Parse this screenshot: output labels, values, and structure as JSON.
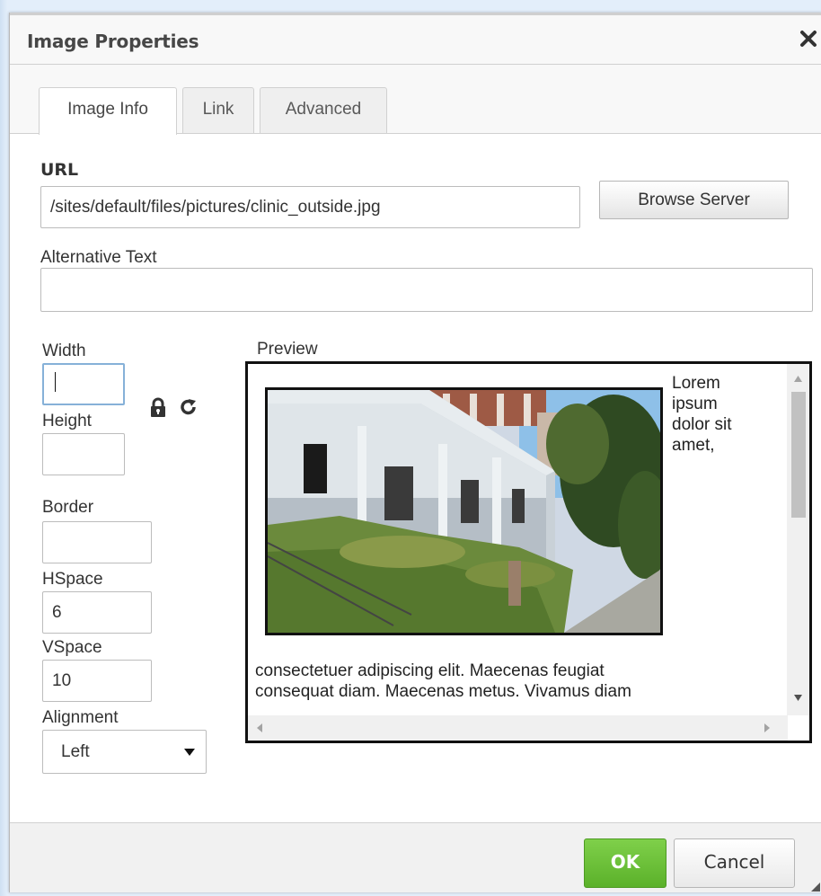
{
  "dialog": {
    "title": "Image Properties",
    "close_glyph": "✕"
  },
  "tabs": [
    {
      "label": "Image Info",
      "active": true
    },
    {
      "label": "Link",
      "active": false
    },
    {
      "label": "Advanced",
      "active": false
    }
  ],
  "url": {
    "label": "URL",
    "value": "/sites/default/files/pictures/clinic_outside.jpg"
  },
  "browse_button": "Browse Server",
  "alt_text": {
    "label": "Alternative Text",
    "value": ""
  },
  "fields": {
    "width": {
      "label": "Width",
      "value": ""
    },
    "height": {
      "label": "Height",
      "value": ""
    },
    "border": {
      "label": "Border",
      "value": ""
    },
    "hspace": {
      "label": "HSpace",
      "value": "6"
    },
    "vspace": {
      "label": "VSpace",
      "value": "10"
    },
    "alignment": {
      "label": "Alignment",
      "value": "Left"
    }
  },
  "icons": {
    "lock": "lock-icon",
    "reset": "reset-size-icon",
    "dropdown": "chevron-down-icon"
  },
  "preview": {
    "label": "Preview",
    "side_text": [
      "Lorem",
      "ipsum",
      "dolor sit",
      "amet,"
    ],
    "body_lines": [
      "consectetuer adipiscing elit. Maecenas feugiat",
      "consequat diam. Maecenas metus. Vivamus diam"
    ]
  },
  "footer": {
    "ok_label": "OK",
    "cancel_label": "Cancel"
  },
  "colors": {
    "ok_green": "#6cc13a",
    "focus_border": "#86b1d8"
  }
}
